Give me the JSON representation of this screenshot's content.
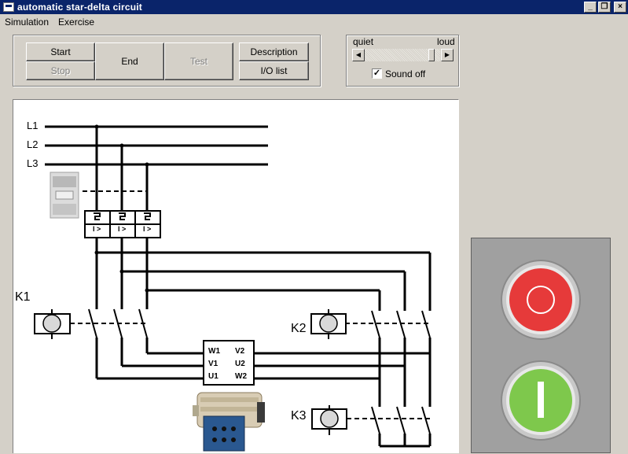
{
  "window": {
    "title": "automatic star-delta circuit"
  },
  "menu": [
    "Simulation",
    "Exercise"
  ],
  "controls": {
    "start": "Start",
    "stop": "Stop",
    "end": "End",
    "test": "Test",
    "description": "Description",
    "io_list": "I/O list"
  },
  "sound": {
    "quiet": "quiet",
    "loud": "loud",
    "volume_level": 0.95,
    "sound_off_label": "Sound off",
    "sound_off_checked": true
  },
  "circuit": {
    "lines": [
      "L1",
      "L2",
      "L3"
    ],
    "breaker_labels": [
      "I >",
      "I >",
      "I >"
    ],
    "contactors": [
      "K1",
      "K2",
      "K3"
    ],
    "motor_terminals": [
      [
        "W1",
        "V2"
      ],
      [
        "V1",
        "U2"
      ],
      [
        "U1",
        "W2"
      ]
    ]
  },
  "pushbuttons": [
    {
      "name": "stop",
      "color": "#e63a3a"
    },
    {
      "name": "start",
      "color": "#7ec84c"
    }
  ]
}
